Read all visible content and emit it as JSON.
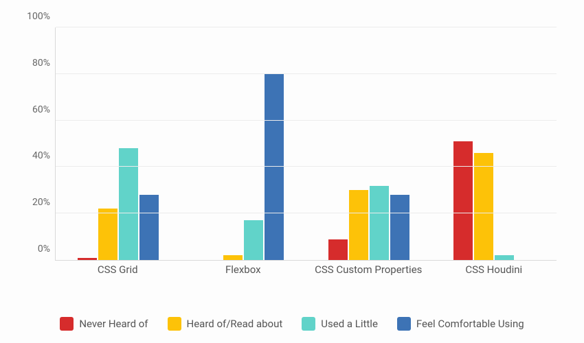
{
  "chart_data": {
    "type": "bar",
    "categories": [
      "CSS Grid",
      "Flexbox",
      "CSS Custom Properties",
      "CSS Houdini"
    ],
    "series": [
      {
        "name": "Never Heard of",
        "color": "#d62c2c",
        "values": [
          1,
          0,
          9,
          51
        ]
      },
      {
        "name": "Heard of/Read about",
        "color": "#fdc208",
        "values": [
          22,
          2,
          30,
          46
        ]
      },
      {
        "name": "Used a Little",
        "color": "#61d3c9",
        "values": [
          48,
          17,
          32,
          2
        ]
      },
      {
        "name": "Feel Comfortable Using",
        "color": "#3d73b5",
        "values": [
          28,
          80,
          28,
          0
        ]
      }
    ],
    "ylim": [
      0,
      100
    ],
    "yticks": [
      0,
      20,
      40,
      60,
      80,
      100
    ],
    "ytick_suffix": "%",
    "title": "",
    "xlabel": "",
    "ylabel": ""
  }
}
